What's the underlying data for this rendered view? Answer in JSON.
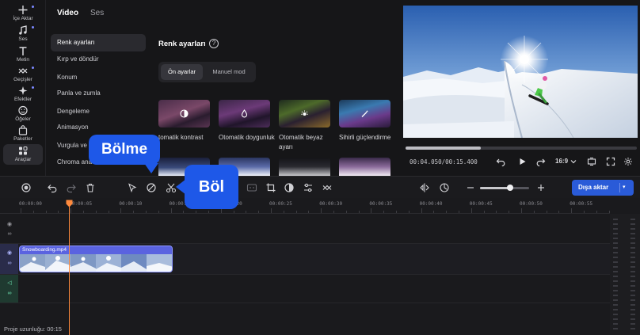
{
  "rail": {
    "items": [
      {
        "name": "import",
        "label": "İçe Aktar"
      },
      {
        "name": "audio",
        "label": "Ses"
      },
      {
        "name": "text",
        "label": "Metin"
      },
      {
        "name": "transitions",
        "label": "Geçişler"
      },
      {
        "name": "effects",
        "label": "Efektler"
      },
      {
        "name": "elements",
        "label": "Öğeler"
      },
      {
        "name": "packages",
        "label": "Paketler"
      },
      {
        "name": "tools",
        "label": "Araçlar"
      }
    ]
  },
  "panel": {
    "tabs": [
      {
        "label": "Video",
        "active": true
      },
      {
        "label": "Ses",
        "active": false
      }
    ],
    "menu": [
      "Renk ayarları",
      "Kırp ve döndür",
      "Konum",
      "Panla ve zumla",
      "Dengeleme",
      "Animasyon",
      "Vurgula ve",
      "Chroma ana"
    ],
    "section_title": "Renk ayarları",
    "help_icon": "?",
    "segments": [
      {
        "label": "Ön ayarlar",
        "active": true
      },
      {
        "label": "Manuel mod",
        "active": false
      }
    ],
    "presets": [
      {
        "label": "tomatik kontrast",
        "icon": "contrast-icon"
      },
      {
        "label": "Otomatik doygunluk",
        "icon": "drop-icon"
      },
      {
        "label": "Otomatik beyaz ayarı",
        "icon": "sun-icon"
      },
      {
        "label": "Sihirli güçlendirme",
        "icon": "magic-wand-icon"
      }
    ]
  },
  "preview": {
    "timecode": "00:04.050/00:15.400",
    "progress_fraction": 0.325,
    "aspect_ratio": "16:9"
  },
  "timeline": {
    "ticks": [
      "00:00:00",
      "00:00:05",
      "00:00:10",
      "00:00:15",
      "00:00:20",
      "00:00:25",
      "00:00:30",
      "00:00:35",
      "00:00:40",
      "00:00:45",
      "00:00:50",
      "00:00:55"
    ],
    "clip_name": "Snowboarding.mp4",
    "playhead_time": "00:00:05",
    "zoom_fraction": 0.62,
    "status": "Proje uzunluğu: 00:15"
  },
  "export": {
    "label": "Dışa aktar"
  },
  "callouts": {
    "split_tool": "Bölme",
    "split": "Böl"
  },
  "colors": {
    "accent": "#2a5bd8",
    "callout": "#1e58e8",
    "playhead": "#ff8a3d",
    "clip": "#4c56d8"
  }
}
